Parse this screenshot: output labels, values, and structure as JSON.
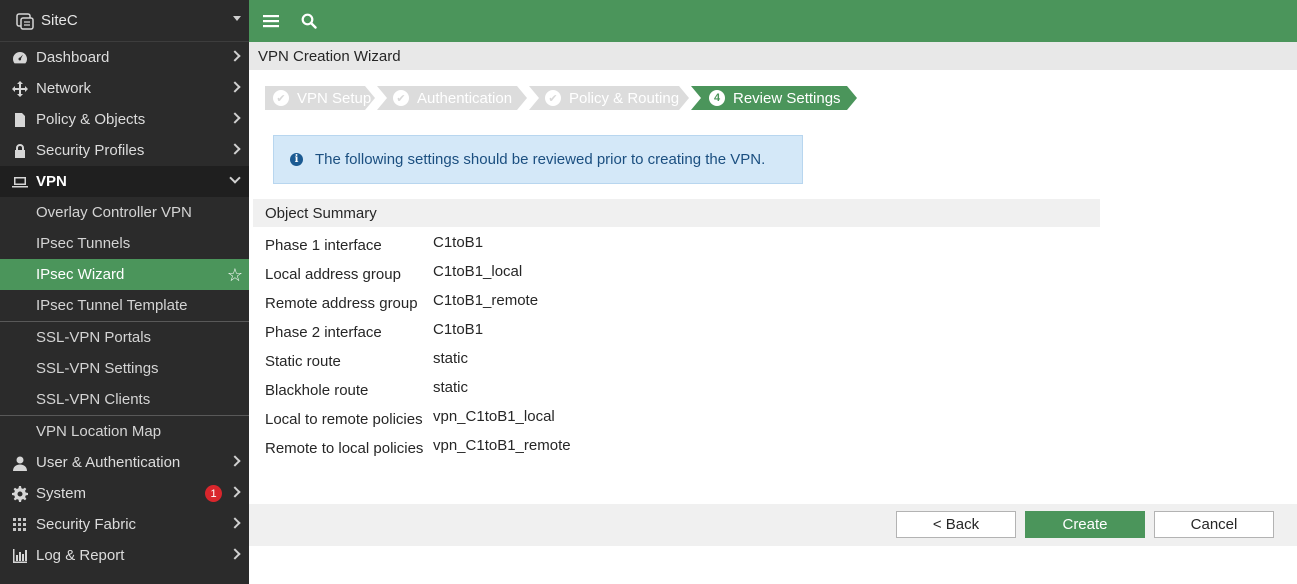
{
  "sidebar": {
    "site_name": "SiteC",
    "items": [
      {
        "label": "Dashboard",
        "icon": "dashboard-icon"
      },
      {
        "label": "Network",
        "icon": "network-icon"
      },
      {
        "label": "Policy & Objects",
        "icon": "policy-icon"
      },
      {
        "label": "Security Profiles",
        "icon": "lock-icon"
      },
      {
        "label": "VPN",
        "icon": "laptop-icon"
      }
    ],
    "vpn_sub": {
      "overlay": "Overlay Controller VPN",
      "ipsec_tunnels": "IPsec Tunnels",
      "ipsec_wizard": "IPsec Wizard",
      "ipsec_template": "IPsec Tunnel Template",
      "ssl_portals": "SSL-VPN Portals",
      "ssl_settings": "SSL-VPN Settings",
      "ssl_clients": "SSL-VPN Clients",
      "location_map": "VPN Location Map"
    },
    "bottom_items": [
      {
        "label": "User & Authentication",
        "icon": "user-icon"
      },
      {
        "label": "System",
        "icon": "gear-icon",
        "badge": "1"
      },
      {
        "label": "Security Fabric",
        "icon": "fabric-icon"
      },
      {
        "label": "Log & Report",
        "icon": "chart-icon"
      }
    ]
  },
  "main": {
    "page_title": "VPN Creation Wizard",
    "steps": {
      "s1": "VPN Setup",
      "s2": "Authentication",
      "s3": "Policy & Routing",
      "s4": "Review Settings",
      "s4_num": "4"
    },
    "info_message": "The following settings should be reviewed prior to creating the VPN.",
    "summary_title": "Object Summary",
    "summary": [
      {
        "label": "Phase 1 interface",
        "value": "C1toB1"
      },
      {
        "label": "Local address group",
        "value": "C1toB1_local"
      },
      {
        "label": "Remote address group",
        "value": "C1toB1_remote"
      },
      {
        "label": "Phase 2 interface",
        "value": "C1toB1"
      },
      {
        "label": "Static route",
        "value": "static"
      },
      {
        "label": "Blackhole route",
        "value": "static"
      },
      {
        "label": "Local to remote policies",
        "value": "vpn_C1toB1_local"
      },
      {
        "label": "Remote to local policies",
        "value": "vpn_C1toB1_remote"
      }
    ],
    "buttons": {
      "back": "< Back",
      "create": "Create",
      "cancel": "Cancel"
    }
  },
  "colors": {
    "accent": "#4b955b",
    "sidebar_bg": "#2b2b2b",
    "info_bg": "#d4e8f8",
    "badge": "#d9262c"
  }
}
